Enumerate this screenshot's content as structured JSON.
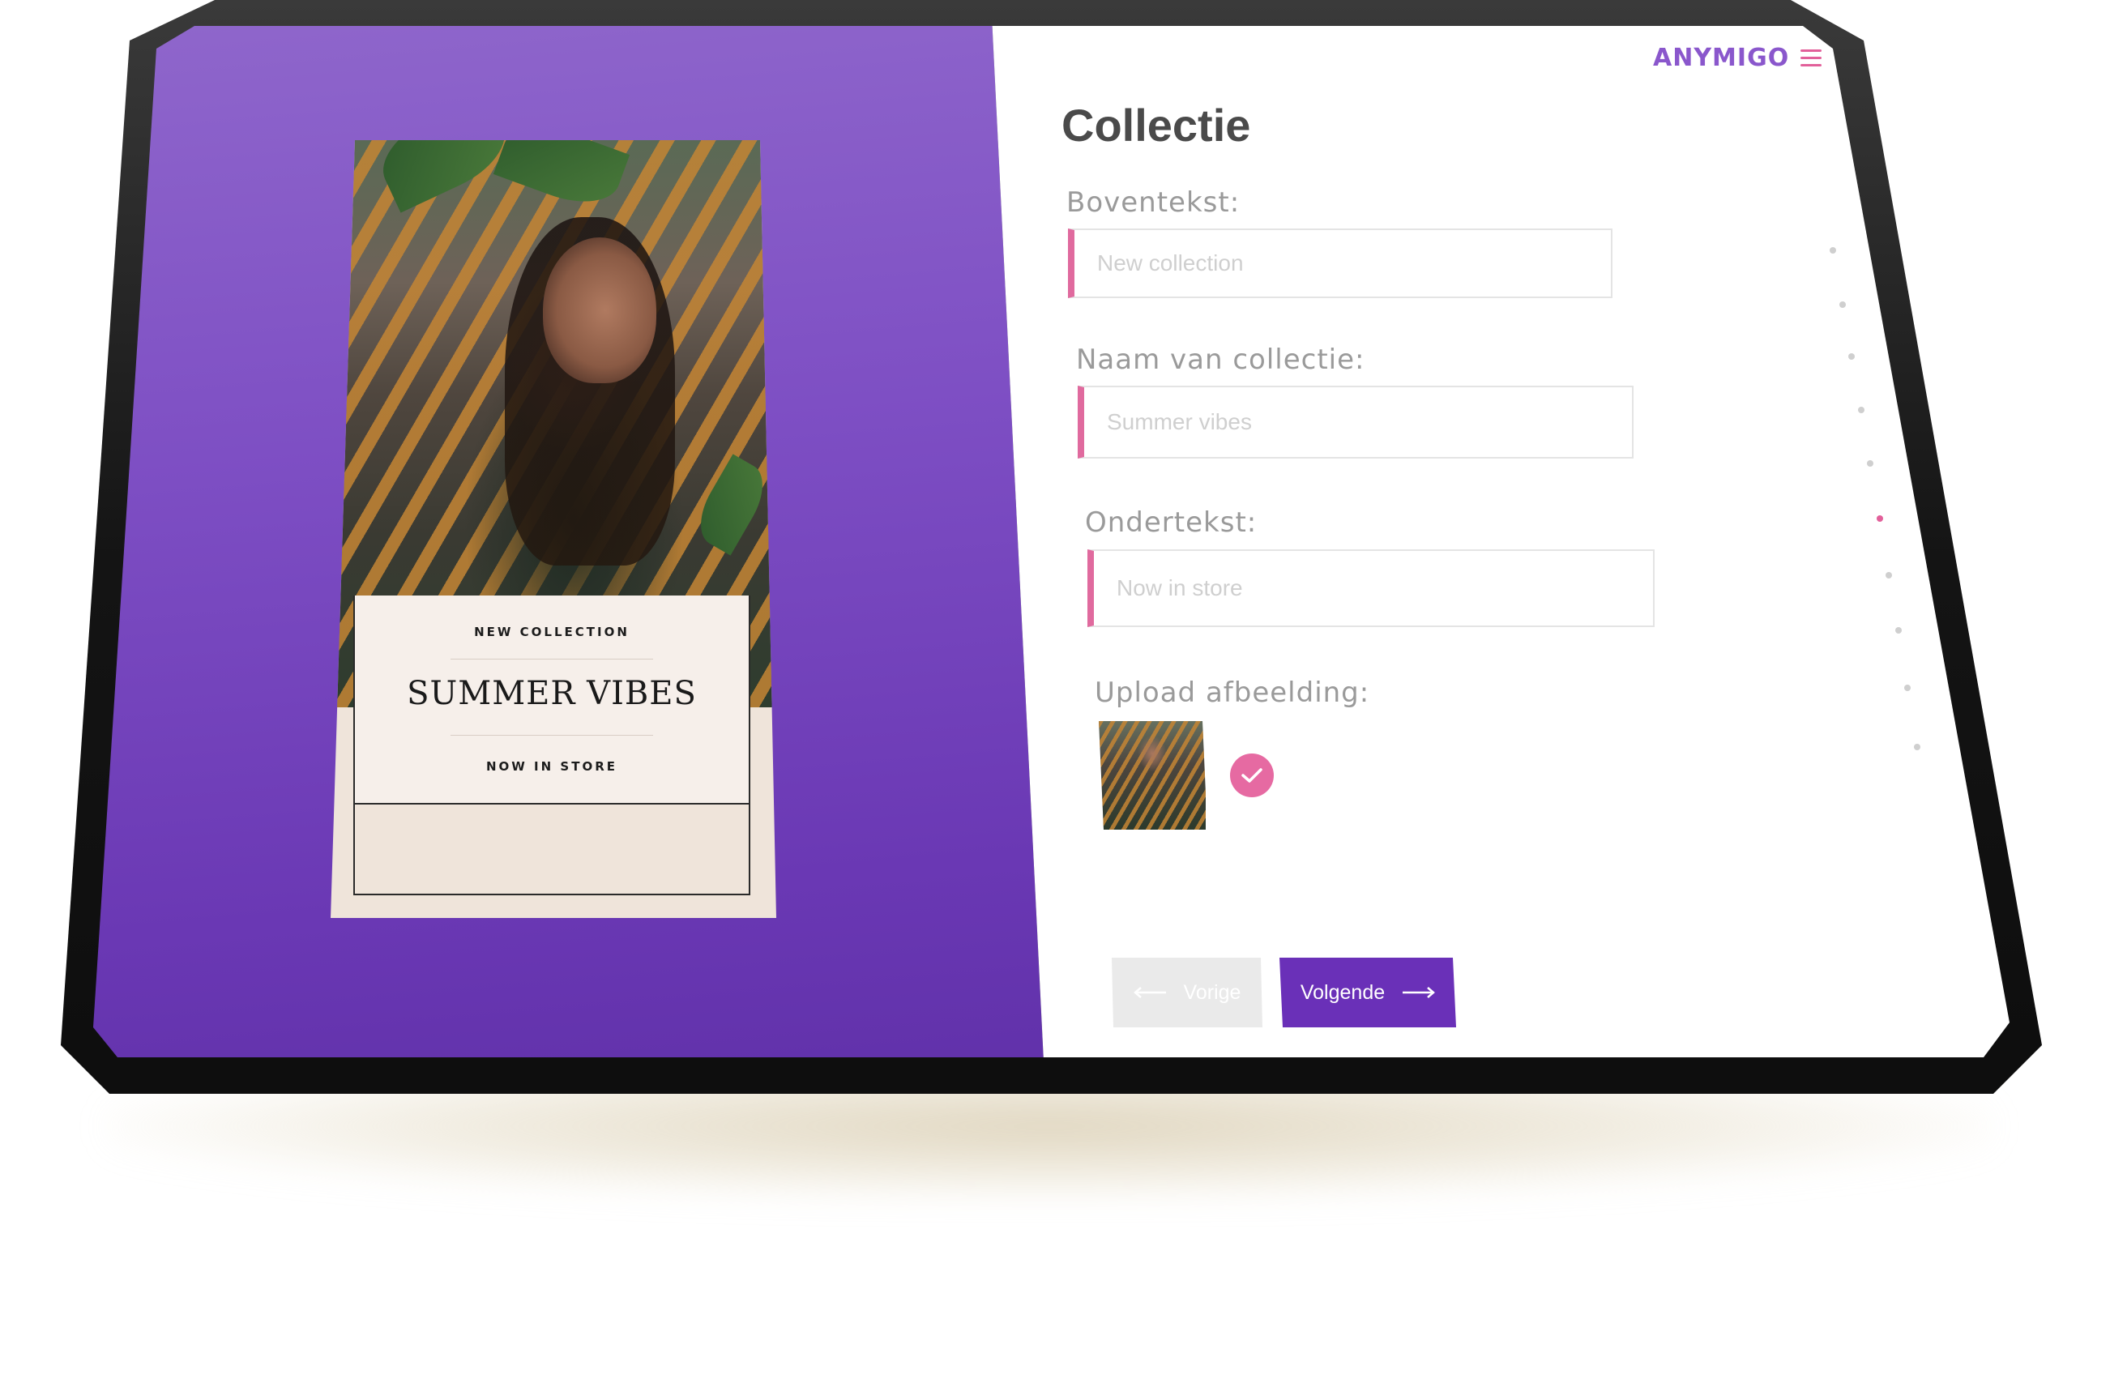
{
  "brand": {
    "logo": "ANYMIGO",
    "menu_icon": "hamburger-menu-icon"
  },
  "page": {
    "title": "Collectie"
  },
  "form": {
    "top_text": {
      "label": "Boventekst:",
      "placeholder": "New collection"
    },
    "collection_name": {
      "label": "Naam van collectie:",
      "placeholder": "Summer vibes"
    },
    "bottom_text": {
      "label": "Ondertekst:",
      "placeholder": "Now in store"
    },
    "upload": {
      "label": "Upload afbeelding:",
      "status_icon": "checkmark-icon"
    }
  },
  "buttons": {
    "prev": "Vorige",
    "next": "Volgende"
  },
  "preview": {
    "top_line": "NEW COLLECTION",
    "title": "SUMMER VIBES",
    "bottom_line": "NOW IN STORE"
  },
  "steps": {
    "count": 10,
    "active_index": 5
  },
  "colors": {
    "purple_panel": "#7e4fc4",
    "accent_pink": "#e2609a",
    "primary_button": "#6a30b8",
    "brand_purple": "#8a57cc"
  }
}
